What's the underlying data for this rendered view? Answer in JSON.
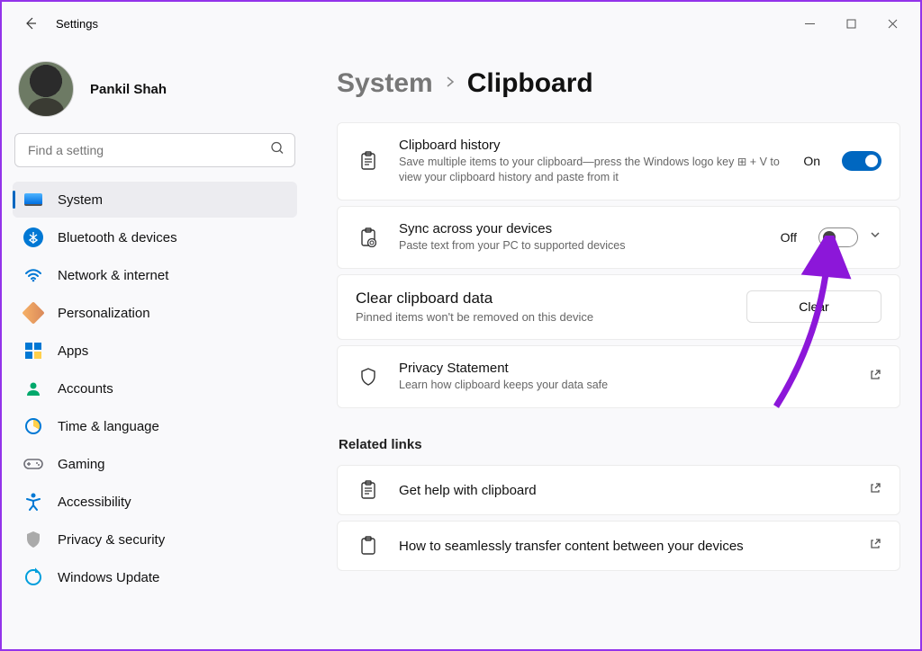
{
  "window": {
    "title": "Settings"
  },
  "profile": {
    "name": "Pankil Shah"
  },
  "search": {
    "placeholder": "Find a setting"
  },
  "nav": {
    "items": [
      {
        "label": "System"
      },
      {
        "label": "Bluetooth & devices"
      },
      {
        "label": "Network & internet"
      },
      {
        "label": "Personalization"
      },
      {
        "label": "Apps"
      },
      {
        "label": "Accounts"
      },
      {
        "label": "Time & language"
      },
      {
        "label": "Gaming"
      },
      {
        "label": "Accessibility"
      },
      {
        "label": "Privacy & security"
      },
      {
        "label": "Windows Update"
      }
    ]
  },
  "breadcrumb": {
    "parent": "System",
    "current": "Clipboard"
  },
  "cards": {
    "history": {
      "title": "Clipboard history",
      "desc": "Save multiple items to your clipboard—press the Windows logo key ⊞ + V to view your clipboard history and paste from it",
      "state": "On"
    },
    "sync": {
      "title": "Sync across your devices",
      "desc": "Paste text from your PC to supported devices",
      "state": "Off"
    },
    "clear": {
      "title": "Clear clipboard data",
      "desc": "Pinned items won't be removed on this device",
      "button": "Clear"
    },
    "privacy": {
      "title": "Privacy Statement",
      "desc": "Learn how clipboard keeps your data safe"
    }
  },
  "related": {
    "heading": "Related links",
    "help": "Get help with clipboard",
    "transfer": "How to seamlessly transfer content between your devices"
  },
  "colors": {
    "accent": "#0067c0",
    "annotation": "#8c17d9"
  }
}
